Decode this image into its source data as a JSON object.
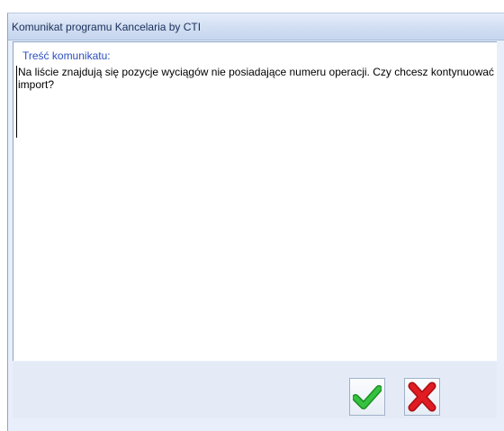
{
  "window": {
    "title": "Komunikat programu Kancelaria by CTI"
  },
  "message": {
    "label": "Treść komunikatu:",
    "text": "Na liście znajdują się pozycje wyciągów nie posiadające numeru operacji. Czy chcesz kontynuować import?"
  },
  "buttons": {
    "ok_icon": "check-icon",
    "cancel_icon": "x-icon"
  },
  "colors": {
    "ok": "#1fa32b",
    "cancel": "#d4141c",
    "label": "#2b4fbf"
  }
}
